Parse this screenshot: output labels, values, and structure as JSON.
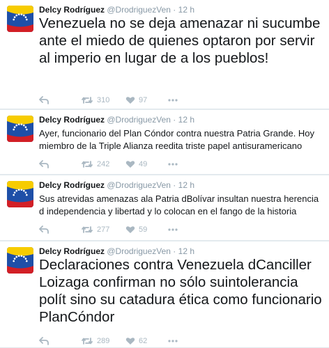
{
  "colors": {
    "name": "#14171a",
    "meta": "#8899a6",
    "action_icon": "#aab8c2",
    "background": "#e6ecf0",
    "flag_yellow": "#f7cc00",
    "flag_blue": "#1e4fa8",
    "flag_red": "#d21f26",
    "flag_stars": "#ffffff"
  },
  "icons": {
    "reply": "reply-arrow-icon",
    "retweet": "retweet-icon",
    "like": "heart-icon",
    "more": "more-dots-icon"
  },
  "tweets": [
    {
      "name": "Delcy Rodríguez",
      "handle": "@DrodriguezVen",
      "time": "12 h",
      "text": "Venezuela no se deja amenazar ni sucumbe ante el miedo de quienes optaron por servir al imperio en lugar de a los pueblos!",
      "retweets": "310",
      "likes": "97"
    },
    {
      "name": "Delcy Rodríguez",
      "handle": "@DrodriguezVen",
      "time": "12 h",
      "text": "Ayer, funcionario del Plan Cóndor contra nuestra Patria Grande. Hoy miembro de la Triple Alianza reedita triste papel antisuramericano",
      "retweets": "242",
      "likes": "49"
    },
    {
      "name": "Delcy Rodríguez",
      "handle": "@DrodriguezVen",
      "time": "12 h",
      "text": "Sus atrevidas amenazas ala Patria dBolívar insultan nuestra herencia d independencia y libertad y lo colocan en el fango de la historia",
      "retweets": "277",
      "likes": "59"
    },
    {
      "name": "Delcy Rodríguez",
      "handle": "@DrodriguezVen",
      "time": "12 h",
      "text": "Declaraciones contra Venezuela dCanciller Loizaga confirman no sólo suintolerancia polít sino su catadura ética como funcionario PlanCóndor",
      "retweets": "289",
      "likes": "62"
    }
  ]
}
